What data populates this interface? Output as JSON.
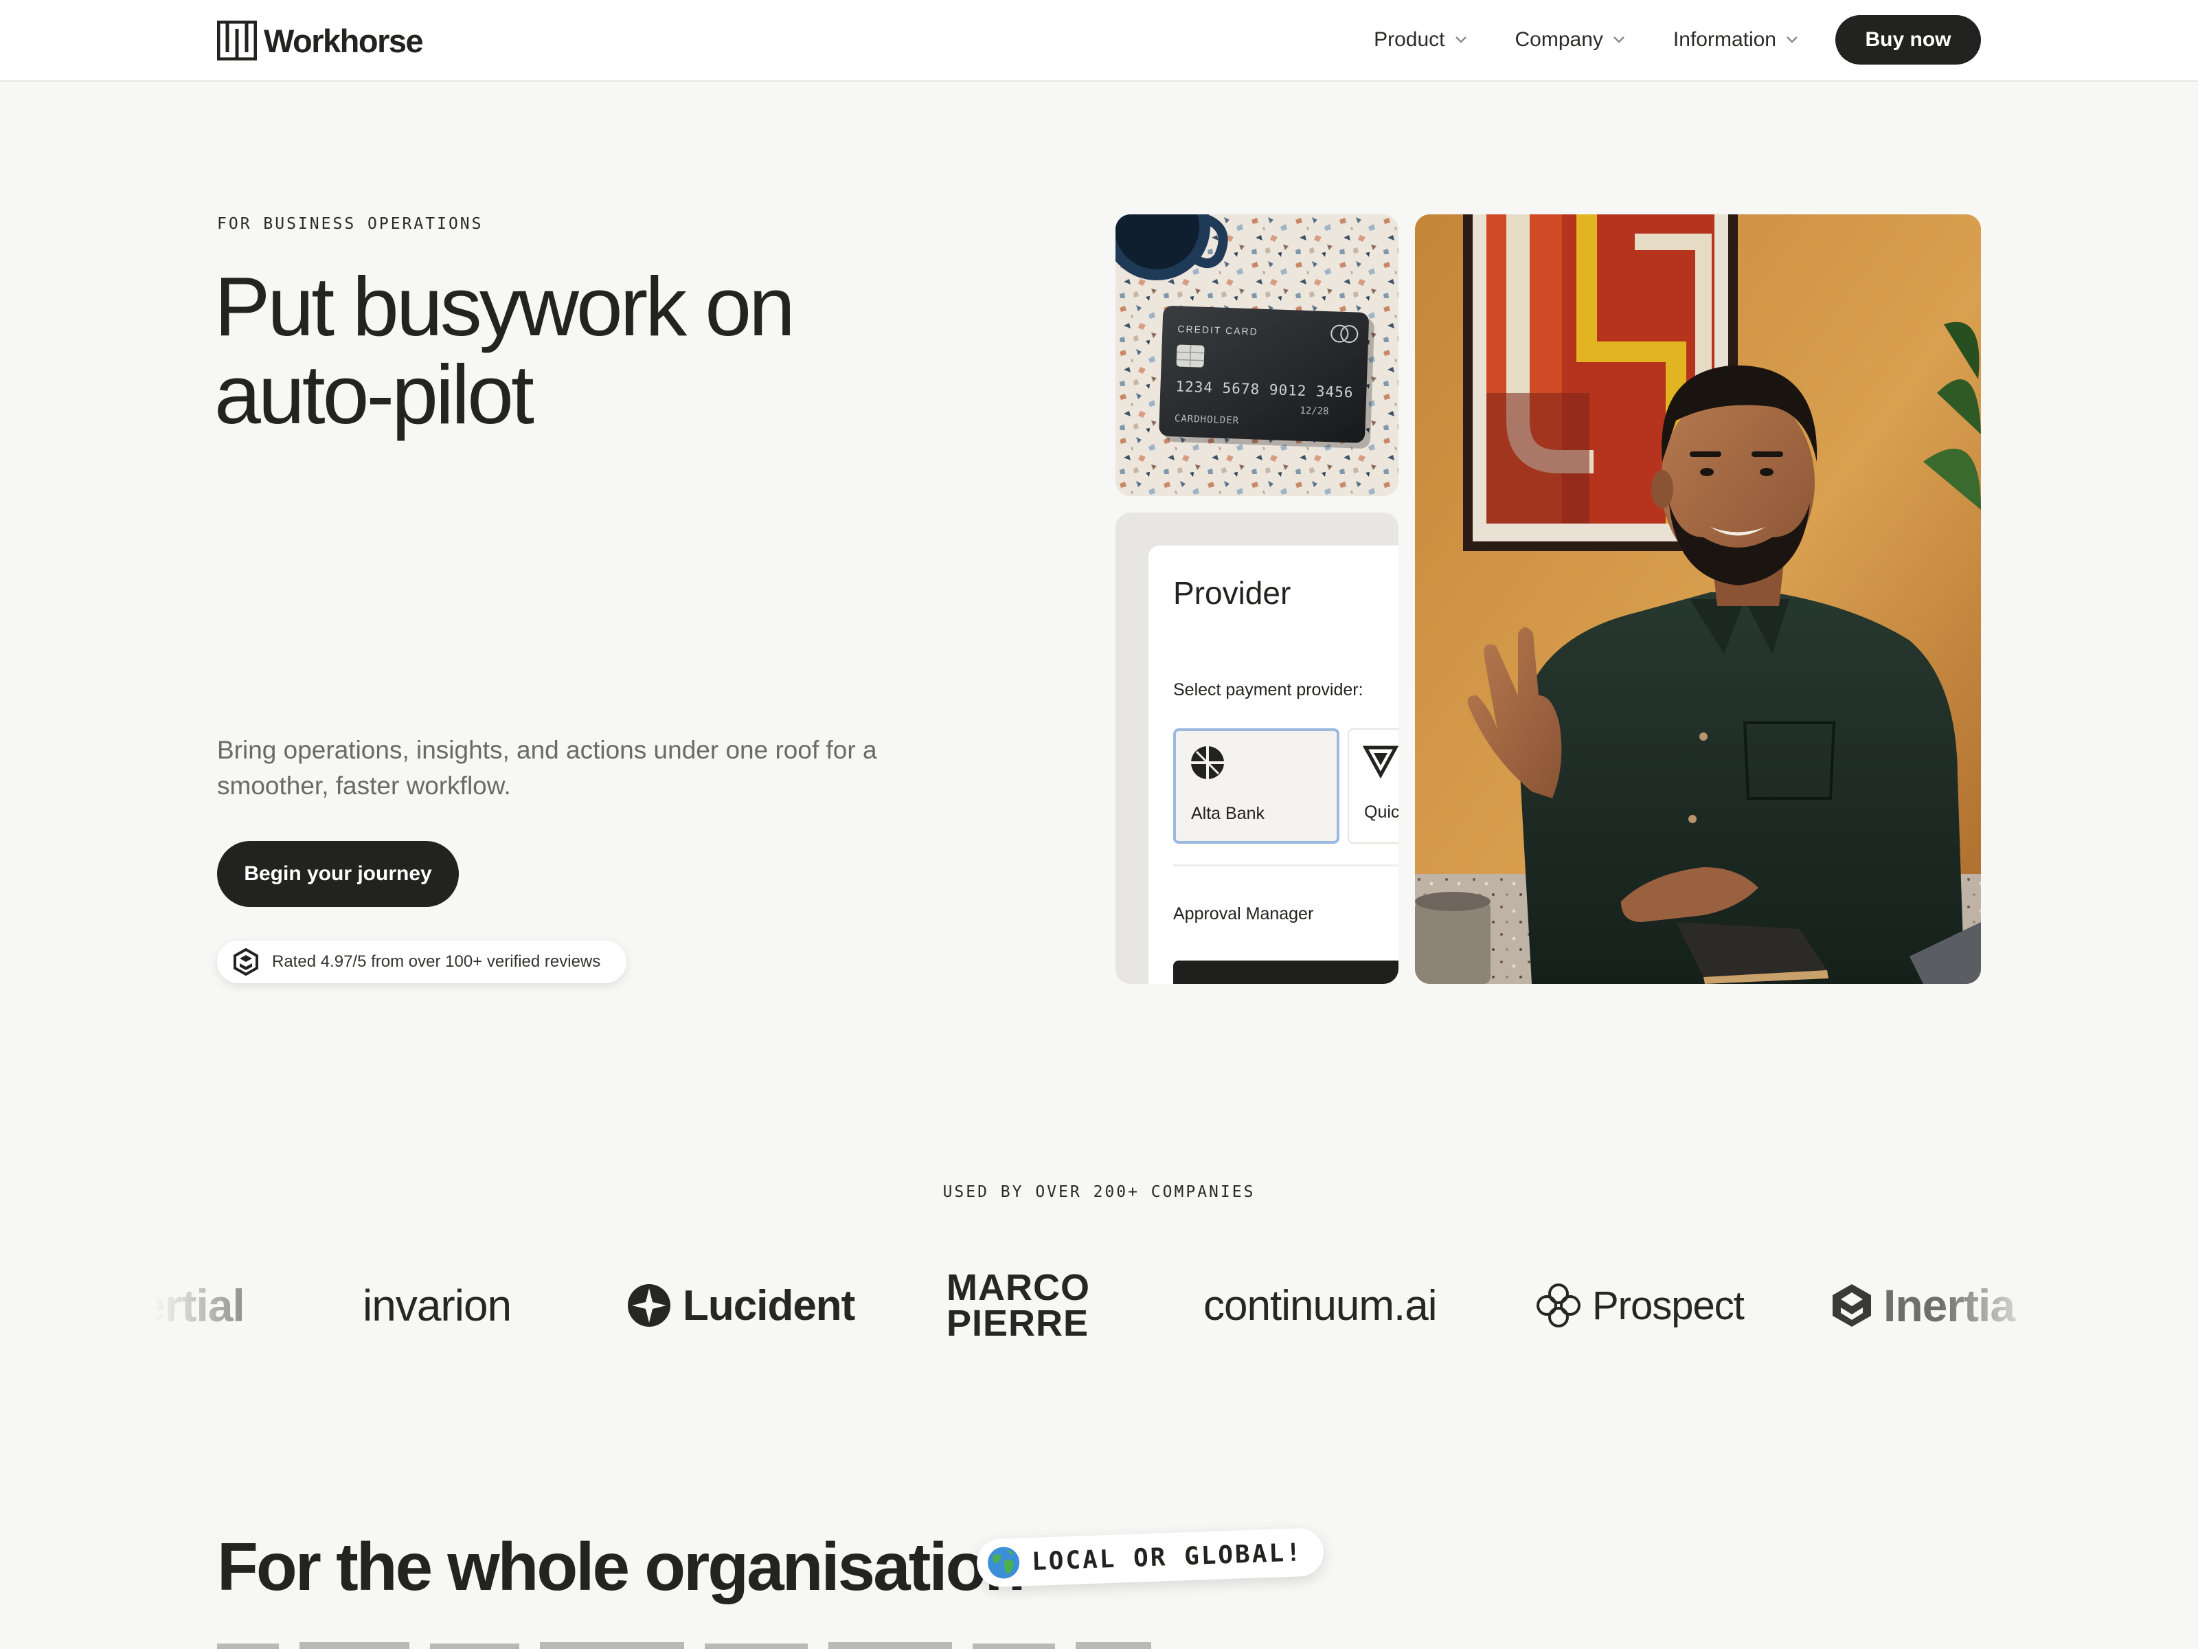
{
  "header": {
    "brand": "Workhorse",
    "nav": [
      {
        "label": "Product"
      },
      {
        "label": "Company"
      },
      {
        "label": "Information"
      }
    ],
    "buy_label": "Buy now"
  },
  "hero": {
    "eyebrow": "FOR BUSINESS OPERATIONS",
    "title_line1": "Put busywork on",
    "title_line2": "auto-pilot",
    "description": "Bring operations, insights, and actions under one roof for a smoother, faster workflow.",
    "cta_label": "Begin your journey",
    "rating_text": "Rated 4.97/5 from over 100+ verified reviews"
  },
  "card_mockup": {
    "label": "CREDIT CARD",
    "number": "1234 5678 9012 3456",
    "expiry": "12/28",
    "holder": "CARDHOLDER"
  },
  "provider_panel": {
    "title": "Provider",
    "select_label": "Select payment provider:",
    "options": [
      {
        "name": "Alta Bank",
        "selected": true,
        "icon": "alta-bank-icon"
      },
      {
        "name": "Quic",
        "selected": false,
        "icon": "quic-icon"
      }
    ],
    "approval_label": "Approval Manager"
  },
  "social_proof": {
    "heading": "USED BY OVER 200+ COMPANIES",
    "brands": [
      {
        "name": "ertial"
      },
      {
        "name": "invarion"
      },
      {
        "name": "Lucident"
      },
      {
        "name_line1": "MARCO",
        "name_line2": "PIERRE"
      },
      {
        "name": "continuum.ai"
      },
      {
        "name": "Prospect"
      },
      {
        "name": "Inertia"
      }
    ]
  },
  "section": {
    "title": "For the whole organisation",
    "tag": "LOCAL OR GLOBAL!"
  },
  "colors": {
    "primary_dark": "#222220",
    "background": "#f7f7f6",
    "selected_border": "#9bb8de"
  }
}
